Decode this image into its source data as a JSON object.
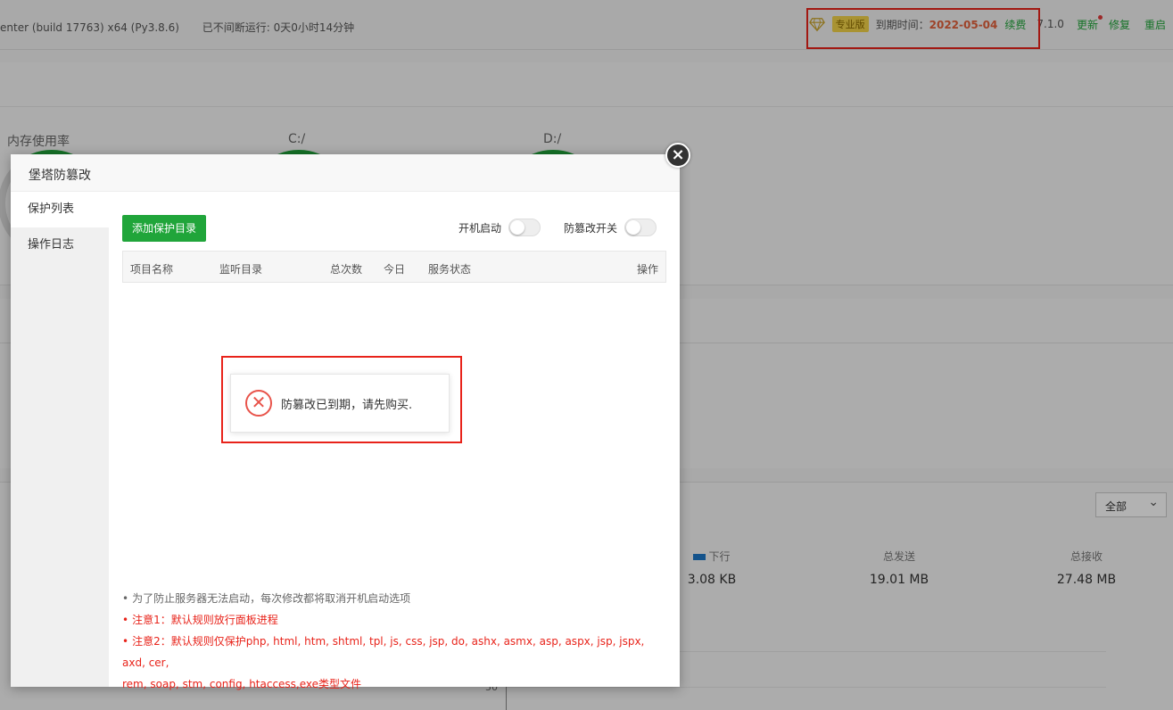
{
  "topbar": {
    "os_info": "enter (build 17763) x64 (Py3.8.6)",
    "uptime": "已不间断运行: 0天0小时14分钟",
    "pro_badge": "专业版",
    "expire_label": "到期时间：",
    "expire_date": "2022-05-04",
    "renew": "续费",
    "version": "7.1.0",
    "update": "更新",
    "repair": "修复",
    "restart": "重启"
  },
  "status": {
    "memory_title": "内存使用率",
    "disk_c_title": "C:/",
    "disk_d_title": "D:/"
  },
  "network": {
    "filter_selected": "全部",
    "down_label": "下行",
    "down_value": "3.08 KB",
    "total_sent_label": "总发送",
    "total_sent_value": "19.01 MB",
    "total_recv_label": "总接收",
    "total_recv_value": "27.48 MB",
    "axis_tick": "50",
    "legend_color": "#1e78c8"
  },
  "modal": {
    "title": "堡塔防篡改",
    "side_items": [
      "保护列表",
      "操作日志"
    ],
    "add_button": "添加保护目录",
    "boot_start_label": "开机启动",
    "tamper_switch_label": "防篡改开关",
    "columns": [
      "项目名称",
      "监听目录",
      "总次数",
      "今日",
      "服务状态",
      "操作"
    ],
    "message": "防篡改已到期，请先购买.",
    "notes": [
      "为了防止服务器无法启动，每次修改都将取消开机启动选项",
      "注意1：默认规则放行面板进程",
      "注意2：默认规则仅保护php, html, htm, shtml, tpl, js, css, jsp, do, ashx, asmx, asp, aspx, jsp, jspx, axd, cer,",
      "rem, soap, stm, config, htaccess,exe类型文件"
    ]
  },
  "colors": {
    "accent": "#20a53a",
    "highlight": "#e8231a",
    "expire": "#e2603b"
  }
}
